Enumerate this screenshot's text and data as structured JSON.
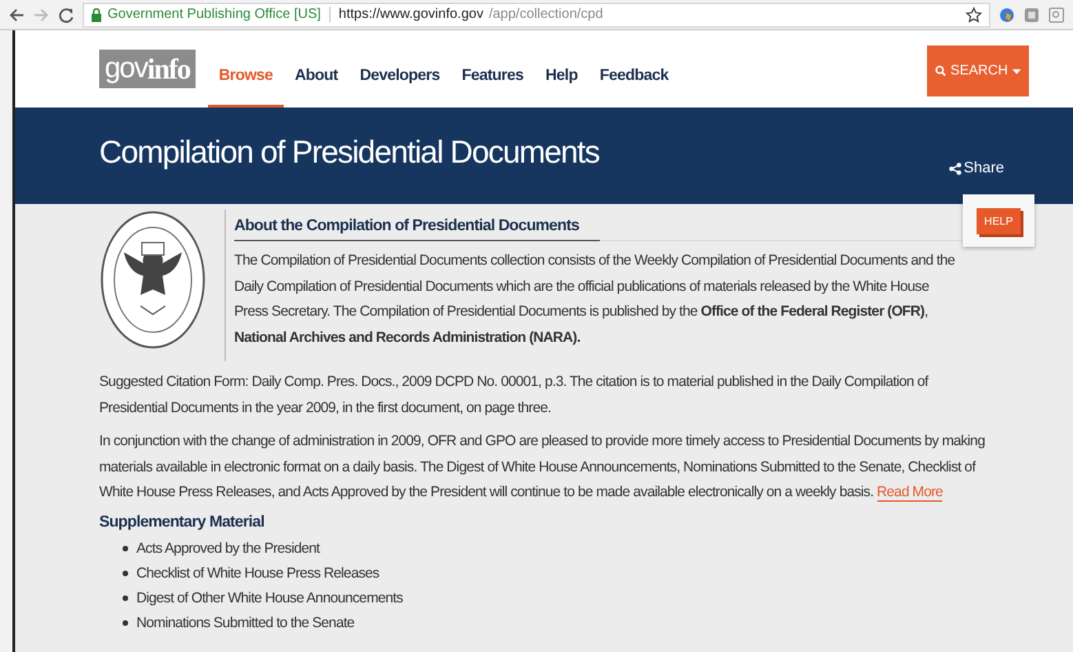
{
  "browser": {
    "site_name": "Government Publishing Office [US]",
    "url_host": "https://www.govinfo.gov",
    "url_path": "/app/collection/cpd"
  },
  "header": {
    "logo_light": "gov",
    "logo_bold": "info",
    "nav": [
      {
        "label": "Browse",
        "selected": true
      },
      {
        "label": "About",
        "selected": false
      },
      {
        "label": "Developers",
        "selected": false
      },
      {
        "label": "Features",
        "selected": false
      },
      {
        "label": "Help",
        "selected": false
      },
      {
        "label": "Feedback",
        "selected": false
      }
    ],
    "search_button": "SEARCH"
  },
  "banner": {
    "title": "Compilation of Presidential Documents",
    "share": "Share"
  },
  "help_button": "HELP",
  "about": {
    "heading": "About the Compilation of Presidential Documents",
    "text": "The Compilation of Presidential Documents collection consists of the Weekly Compilation of Presidential Documents and the Daily Compilation of Presidential Documents which are the official publications of materials released by the White House Press Secretary. The Compilation of Presidential Documents is published by the **Office of the Federal Register (OFR)**, **National Archives and Records Administration (NARA).**"
  },
  "citation": "Suggested Citation Form: Daily Comp. Pres. Docs., 2009 DCPD No. 00001, p.3. The citation is to material published in the Daily Compilation of Presidential Documents in the year 2009, in the first document, on page three.",
  "conjunction": {
    "text": "In conjunction with the change of administration in 2009, OFR and GPO are pleased to provide more timely access to Presidential Documents by making materials available in electronic format on a daily basis. The Digest of White House Announcements, Nominations Submitted to the Senate, Checklist of White House Press Releases, and Acts Approved by the President will continue to be made available electronically on a weekly basis.",
    "link": "Read More"
  },
  "supplementary": {
    "heading": "Supplementary Material",
    "items": [
      "Acts Approved by the President",
      "Checklist of White House Press Releases",
      "Digest of Other White House Announcements",
      "Nominations Submitted to the Senate"
    ]
  }
}
